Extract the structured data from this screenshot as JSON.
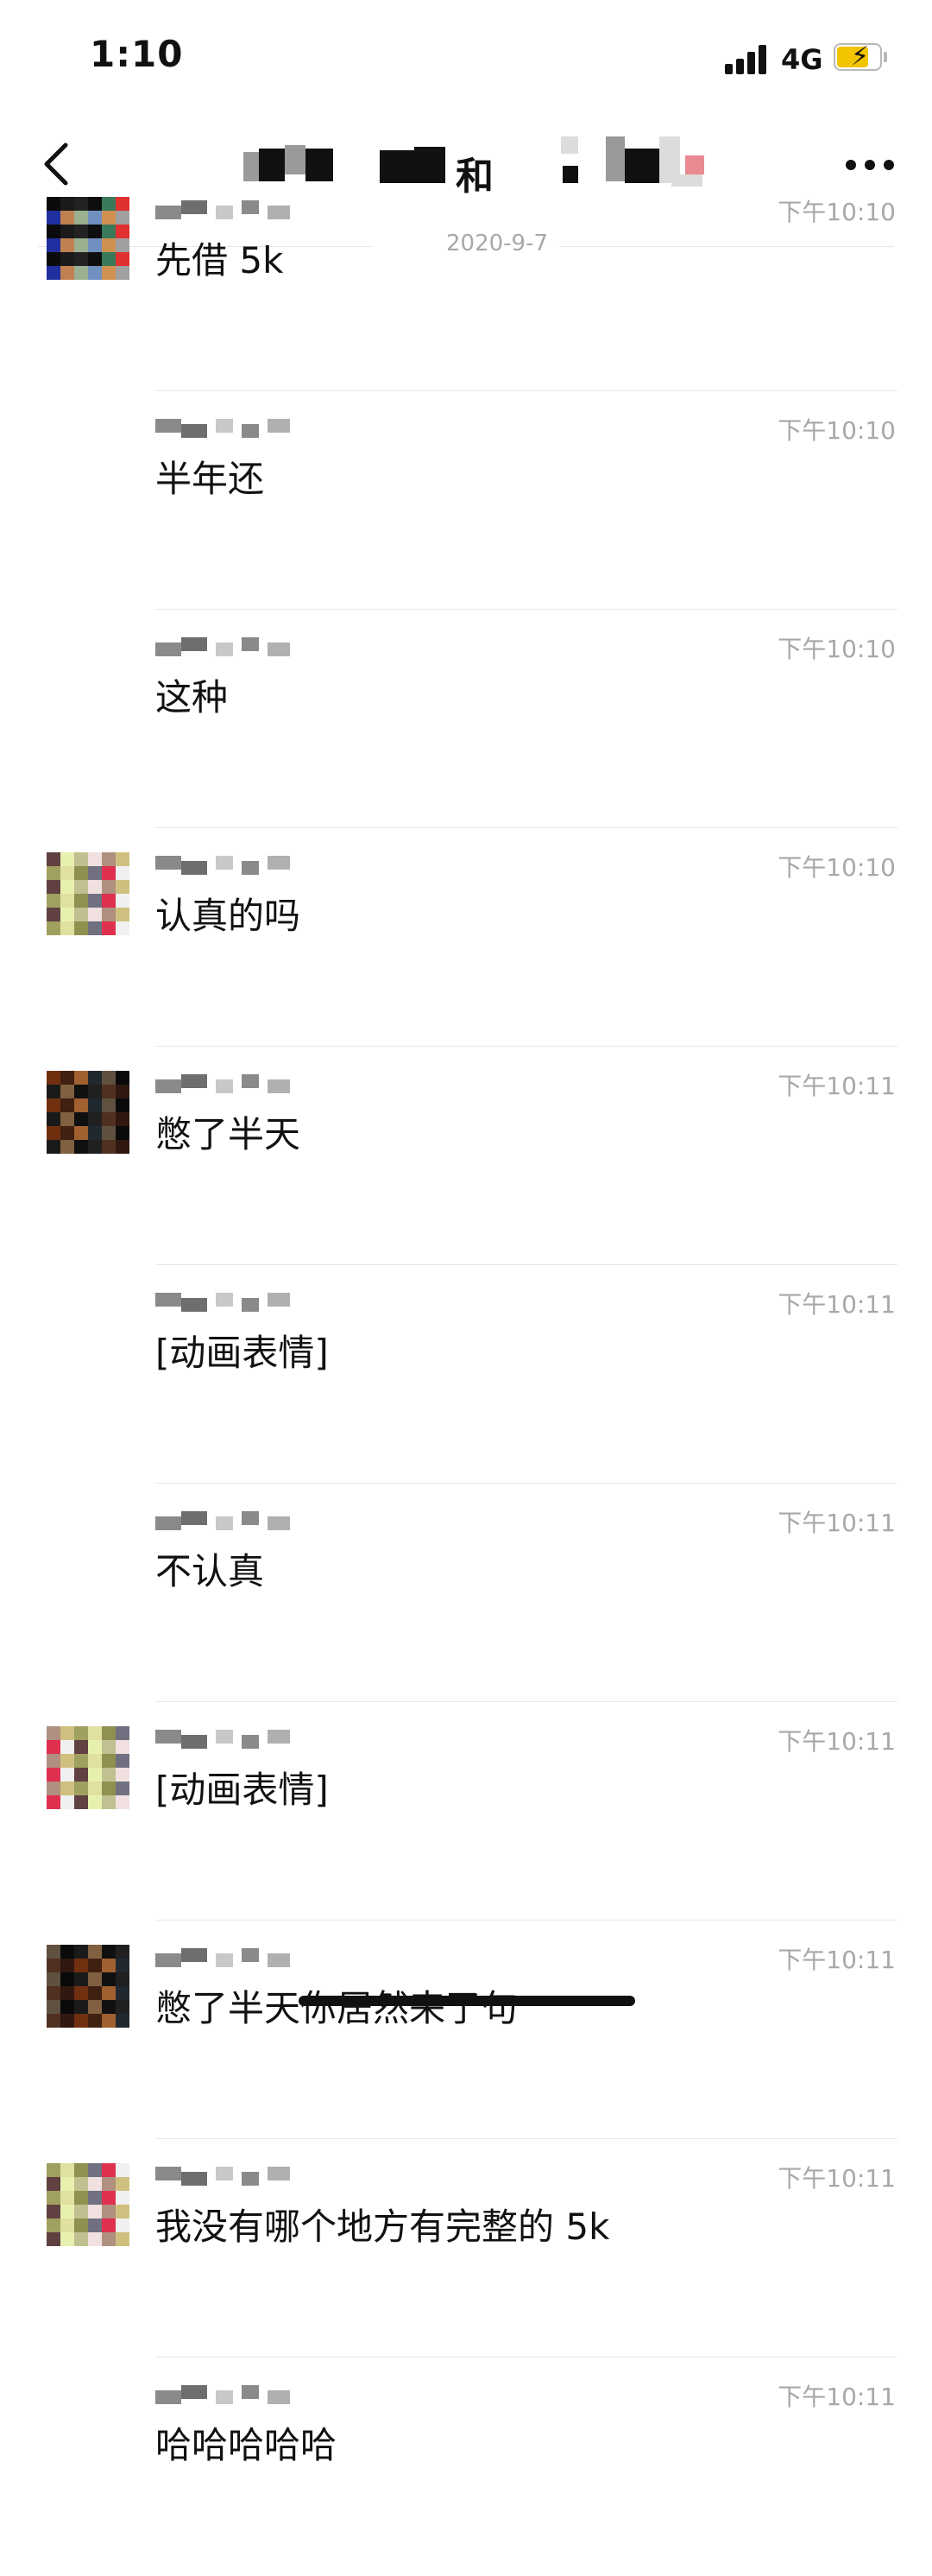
{
  "status": {
    "time": "1:10",
    "network": "4G"
  },
  "header": {
    "title": "和",
    "back_icon": "chevron-left-icon",
    "more_icon": "more-dots-icon"
  },
  "date_separator": "2020-9-7",
  "messages": [
    {
      "time": "下午10:10",
      "text": "先借 5k",
      "has_avatar": true
    },
    {
      "time": "下午10:10",
      "text": "半年还",
      "has_avatar": false
    },
    {
      "time": "下午10:10",
      "text": "这种",
      "has_avatar": false
    },
    {
      "time": "下午10:10",
      "text": "认真的吗",
      "has_avatar": true
    },
    {
      "time": "下午10:11",
      "text": "憋了半天",
      "has_avatar": true
    },
    {
      "time": "下午10:11",
      "text": "[动画表情]",
      "has_avatar": false
    },
    {
      "time": "下午10:11",
      "text": "不认真",
      "has_avatar": false
    },
    {
      "time": "下午10:11",
      "text": "[动画表情]",
      "has_avatar": true
    },
    {
      "time": "下午10:11",
      "text": "憋了半天你居然来了句",
      "has_avatar": true
    },
    {
      "time": "下午10:11",
      "text": "我没有哪个地方有完整的 5k",
      "has_avatar": true
    },
    {
      "time": "下午10:11",
      "text": "哈哈哈哈哈",
      "has_avatar": false
    }
  ]
}
